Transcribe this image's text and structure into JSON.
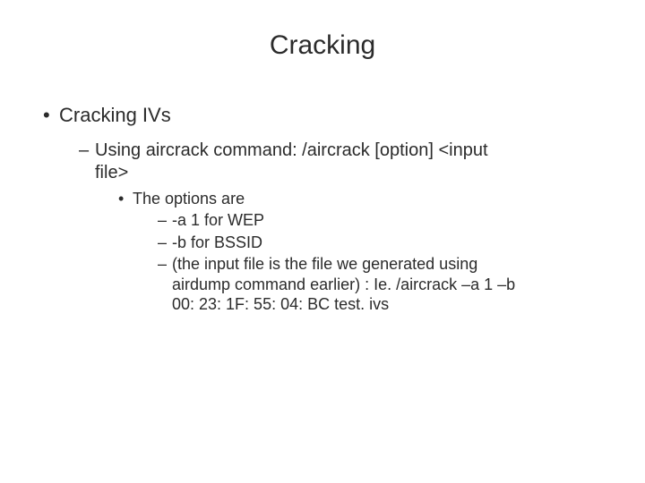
{
  "title": "Cracking",
  "l1": {
    "bullet": "•",
    "text": "Cracking IVs"
  },
  "l2": {
    "dash": "–",
    "line1": "Using aircrack command: /aircrack [option] <input",
    "line2": "file>"
  },
  "l3": {
    "bullet": "•",
    "text": "The options are"
  },
  "l4": {
    "dash": "–",
    "items": [
      {
        "line1": "-a 1 for WEP"
      },
      {
        "line1": "-b for BSSID"
      },
      {
        "line1": "(the input file is the file we generated using",
        "line2": "airdump command earlier) : Ie. /aircrack –a 1 –b",
        "line3": "00: 23: 1F: 55: 04: BC test. ivs"
      }
    ]
  }
}
